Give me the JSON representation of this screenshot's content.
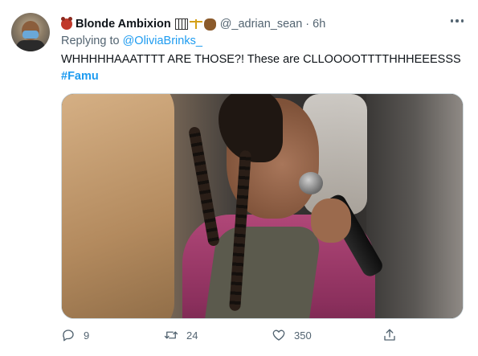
{
  "tweet": {
    "display_name": "Blonde Ambixion",
    "handle": "@_adrian_sean",
    "separator": "·",
    "time": "6h",
    "replying_prefix": "Replying to ",
    "replying_to": "@OliviaBrinks_",
    "text": "WHHHHHAAATTTT ARE THOSE?! These are CLLOOOOTTTTHHHEEESSS",
    "hashtag": "#Famu",
    "name_emojis": [
      "bear-icon",
      "piano-icon",
      "scales-icon",
      "fist-icon"
    ]
  },
  "actions": {
    "replies": "9",
    "retweets": "24",
    "likes": "350"
  },
  "colors": {
    "accent": "#1d9bf0",
    "secondary_text": "#536471",
    "primary_text": "#0f1419"
  }
}
